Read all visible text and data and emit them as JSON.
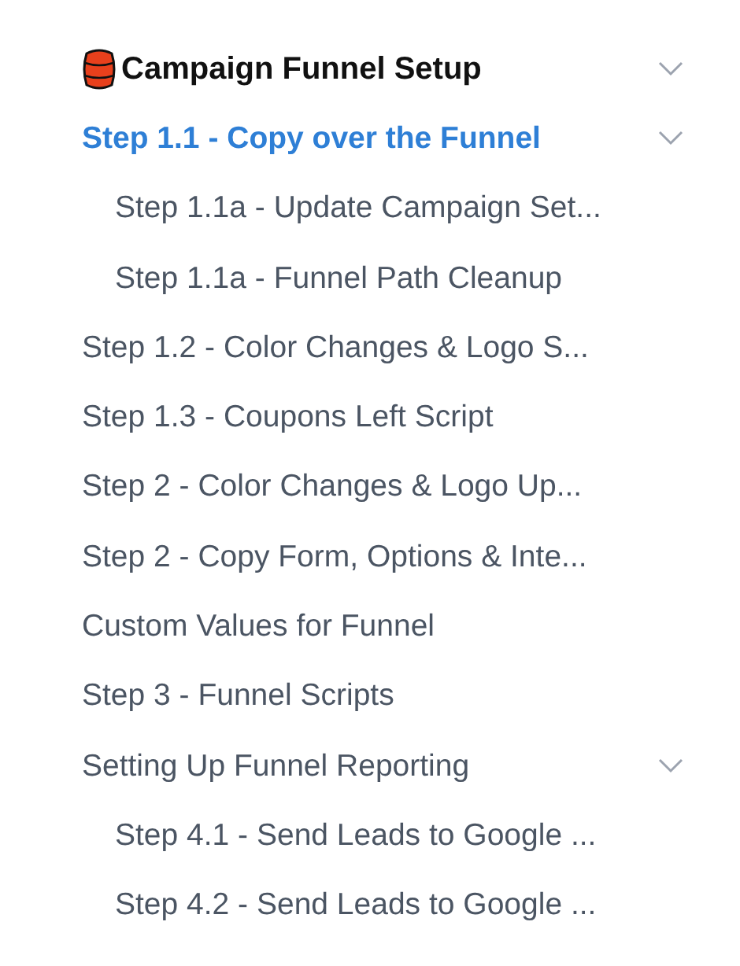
{
  "section": {
    "title": "Campaign Funnel Setup",
    "expanded": true,
    "items": [
      {
        "label": "Step 1.1 - Copy over the Funnel",
        "selected": true,
        "expanded": true,
        "children": [
          {
            "label": "Step 1.1a - Update Campaign Set...",
            "selected": false
          },
          {
            "label": "Step 1.1a - Funnel Path Cleanup",
            "selected": false
          }
        ]
      },
      {
        "label": "Step 1.2 - Color Changes & Logo S...",
        "selected": false
      },
      {
        "label": "Step 1.3 - Coupons Left Script",
        "selected": false
      },
      {
        "label": "Step 2 - Color Changes & Logo Up...",
        "selected": false
      },
      {
        "label": "Step 2 - Copy Form, Options & Inte...",
        "selected": false
      },
      {
        "label": "Custom Values for Funnel",
        "selected": false
      },
      {
        "label": "Step 3 - Funnel Scripts",
        "selected": false
      },
      {
        "label": "Setting Up Funnel Reporting",
        "selected": false,
        "expanded": true,
        "children": [
          {
            "label": "Step 4.1 - Send Leads to Google ...",
            "selected": false
          },
          {
            "label": "Step 4.2 - Send Leads to Google ...",
            "selected": false
          }
        ]
      }
    ]
  }
}
